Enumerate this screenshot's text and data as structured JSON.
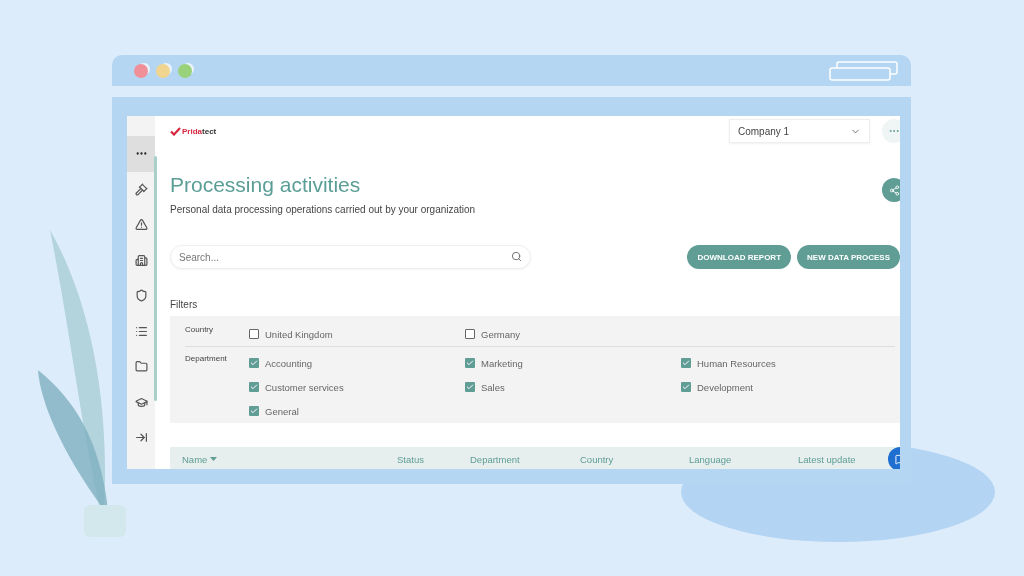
{
  "window": {
    "controls": [
      {
        "color": "#ef8f97"
      },
      {
        "color": "#efd58f"
      },
      {
        "color": "#99d27a"
      }
    ]
  },
  "sidebar": {
    "items": [
      {
        "selected": true
      },
      {
        "selected": false
      },
      {
        "selected": false
      },
      {
        "selected": false
      },
      {
        "selected": false
      },
      {
        "selected": false
      },
      {
        "selected": false
      },
      {
        "selected": false
      },
      {
        "selected": false
      }
    ]
  },
  "header": {
    "logo": {
      "accent": "Prida",
      "rest": "tect"
    },
    "company_select": {
      "value": "Company 1"
    }
  },
  "page": {
    "title": "Processing activities",
    "subtitle": "Personal data processing operations carried out by your organization"
  },
  "search": {
    "placeholder": "Search..."
  },
  "buttons": [
    "DOWNLOAD REPORT",
    "NEW DATA PROCESS"
  ],
  "filters": {
    "label": "Filters",
    "groups": [
      {
        "label": "Country",
        "options": [
          {
            "label": "United Kingdom",
            "checked": false
          },
          {
            "label": "Germany",
            "checked": false
          }
        ]
      },
      {
        "label": "Department",
        "options": [
          {
            "label": "Accounting",
            "checked": true
          },
          {
            "label": "Marketing",
            "checked": true
          },
          {
            "label": "Human Resources",
            "checked": true
          },
          {
            "label": "Customer services",
            "checked": true
          },
          {
            "label": "Sales",
            "checked": true
          },
          {
            "label": "Development",
            "checked": true
          },
          {
            "label": "General",
            "checked": true
          }
        ]
      }
    ]
  },
  "table": {
    "columns": [
      {
        "label": "Name",
        "sorted": true
      },
      {
        "label": "Status",
        "sorted": false
      },
      {
        "label": "Department",
        "sorted": false
      },
      {
        "label": "Country",
        "sorted": false
      },
      {
        "label": "Language",
        "sorted": false
      },
      {
        "label": "Latest update",
        "sorted": false
      }
    ]
  }
}
